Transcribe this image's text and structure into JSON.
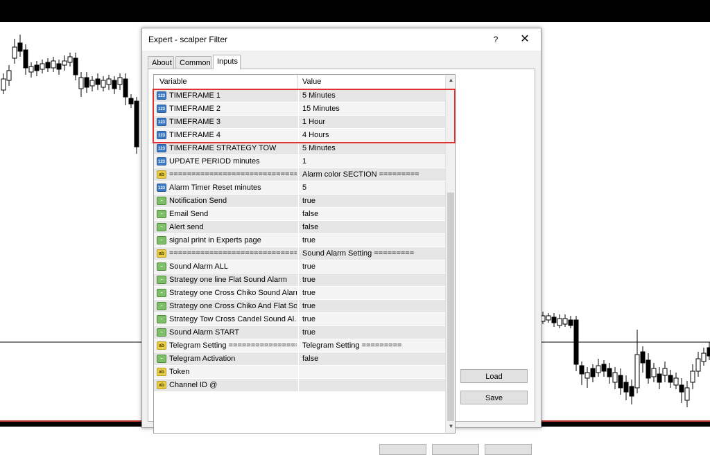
{
  "dialog": {
    "title": "Expert - scalper Filter",
    "help_label": "?",
    "close_label": "✕"
  },
  "tabs": [
    {
      "label": "About"
    },
    {
      "label": "Common"
    },
    {
      "label": "Inputs"
    }
  ],
  "grid": {
    "columns": [
      "Variable",
      "Value"
    ],
    "rows": [
      {
        "type": "num",
        "variable": "TIMEFRAME 1",
        "value": "5 Minutes"
      },
      {
        "type": "num",
        "variable": "TIMEFRAME 2",
        "value": "15 Minutes"
      },
      {
        "type": "num",
        "variable": "TIMEFRAME 3",
        "value": "1 Hour"
      },
      {
        "type": "num",
        "variable": "TIMEFRAME 4",
        "value": "4 Hours"
      },
      {
        "type": "num",
        "variable": "TIMEFRAME STRATEGY TOW",
        "value": "5 Minutes"
      },
      {
        "type": "num",
        "variable": "UPDATE PERIOD minutes",
        "value": "1"
      },
      {
        "type": "ab",
        "variable": "==============================",
        "value": "Alarm color SECTION ========="
      },
      {
        "type": "num",
        "variable": "Alarm Timer Reset minutes",
        "value": "5"
      },
      {
        "type": "bool",
        "variable": "Notification Send",
        "value": "true"
      },
      {
        "type": "bool",
        "variable": "Email Send",
        "value": "false"
      },
      {
        "type": "bool",
        "variable": "Alert send",
        "value": "false"
      },
      {
        "type": "bool",
        "variable": "signal print in Experts page",
        "value": "true"
      },
      {
        "type": "ab",
        "variable": "==============================",
        "value": "Sound Alarm Setting ========="
      },
      {
        "type": "bool",
        "variable": "Sound Alarm ALL",
        "value": "true"
      },
      {
        "type": "bool",
        "variable": "Strategy one line Flat Sound Alarm",
        "value": "true"
      },
      {
        "type": "bool",
        "variable": "Strategy one Cross Chiko Sound Alarm",
        "value": "true"
      },
      {
        "type": "bool",
        "variable": "Strategy one Cross Chiko And Flat So...",
        "value": "true"
      },
      {
        "type": "bool",
        "variable": "Strategy Tow Cross Candel Sound Al...",
        "value": "true"
      },
      {
        "type": "bool",
        "variable": "Sound Alarm START",
        "value": "true"
      },
      {
        "type": "ab",
        "variable": "Telegram Setting =================",
        "value": "Telegram Setting ========="
      },
      {
        "type": "bool",
        "variable": "Telegram Activation",
        "value": "false"
      },
      {
        "type": "ab",
        "variable": "Token",
        "value": ""
      },
      {
        "type": "ab",
        "variable": "Channel ID @",
        "value": ""
      }
    ]
  },
  "icons": {
    "num": "123",
    "ab": "ab",
    "bool": "~"
  },
  "buttons": {
    "load": "Load",
    "save": "Save"
  },
  "colors": {
    "highlight": "#e03030",
    "bull": "#ffffff",
    "bear": "#000000"
  }
}
